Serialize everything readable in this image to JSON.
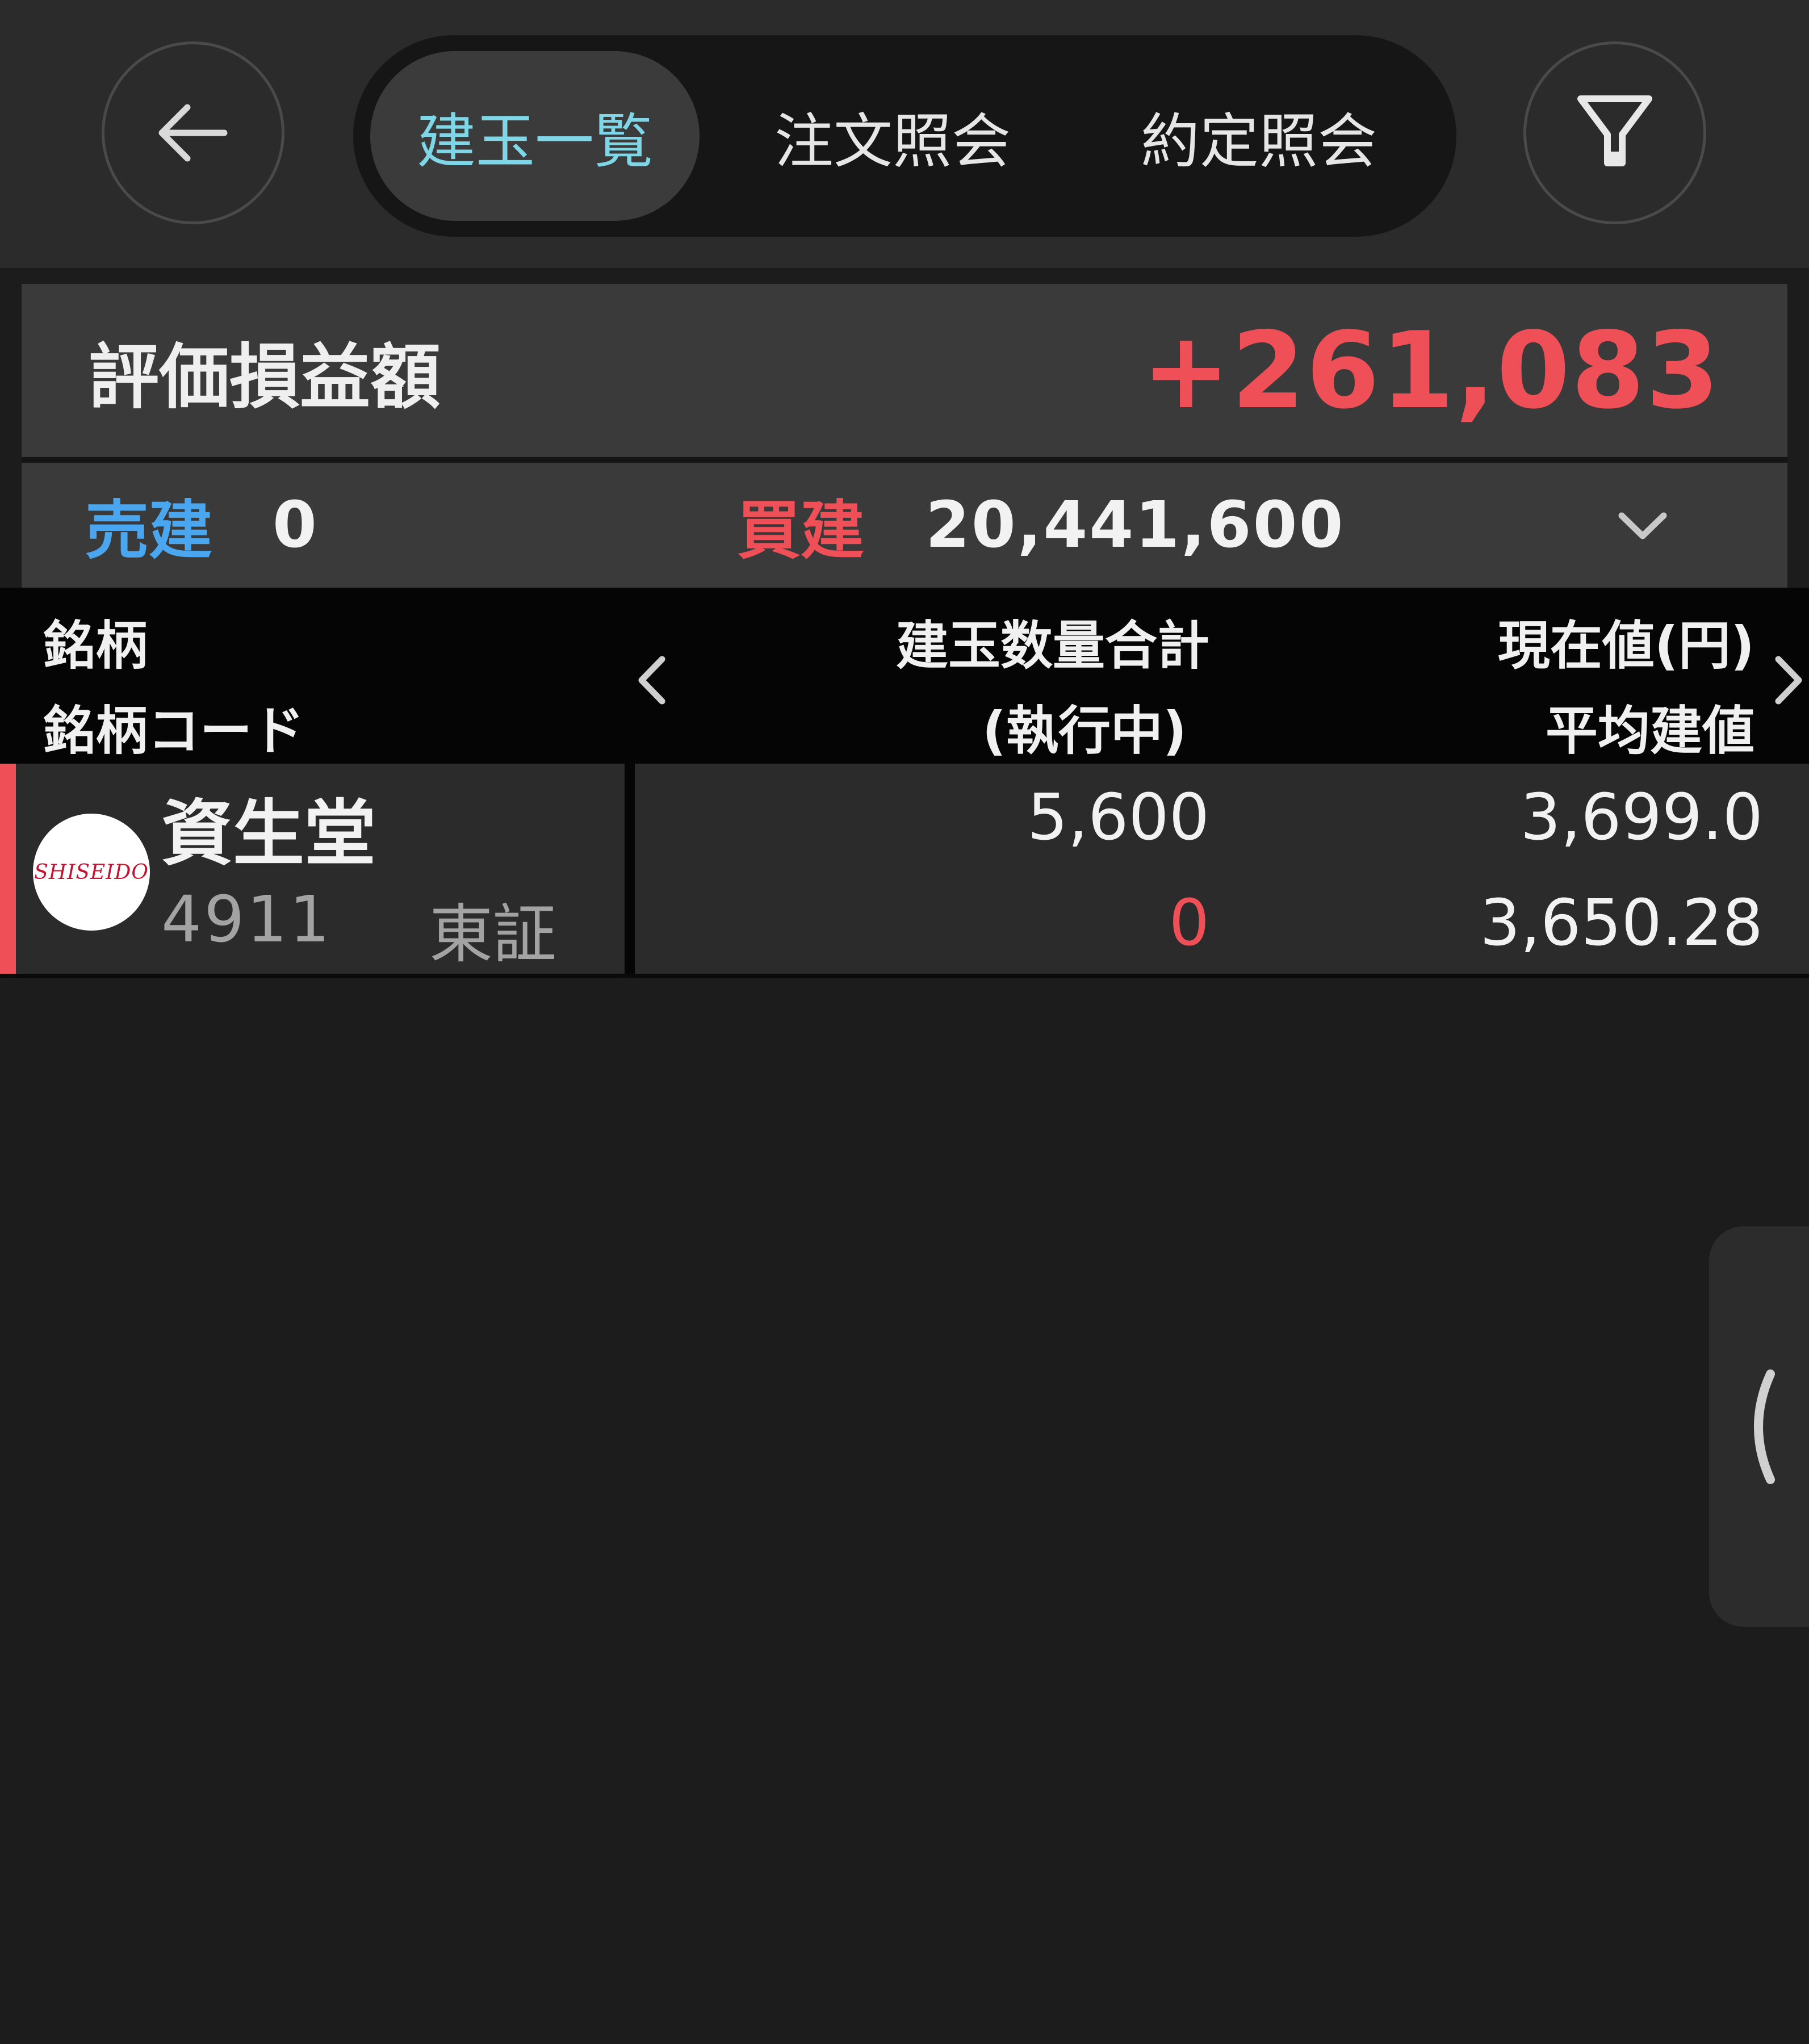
{
  "nav": {
    "tabs": [
      {
        "label": "建玉一覧",
        "active": true
      },
      {
        "label": "注文照会",
        "active": false
      },
      {
        "label": "約定照会",
        "active": false
      }
    ],
    "back_icon": "arrow-left-icon",
    "filter_icon": "filter-icon"
  },
  "summary": {
    "label": "評価損益額",
    "value": "+261,083"
  },
  "breakdown": {
    "sell_label": "売建",
    "sell_value": "0",
    "buy_label": "買建",
    "buy_value": "20,441,600"
  },
  "columns": {
    "name": "銘柄",
    "code": "銘柄コード",
    "quantity_total": "建玉数量合計",
    "executing": "(執行中)",
    "current_price": "現在値(円)",
    "average_price": "平均建値"
  },
  "positions": [
    {
      "logo_text": "SHISEIDO",
      "name": "資生堂",
      "code": "4911",
      "market": "東証",
      "quantity": "5,600",
      "executing": "0",
      "current_price": "3,699.0",
      "average_price": "3,650.28"
    }
  ],
  "colors": {
    "accent_teal": "#7fd6e6",
    "profit_red": "#ef4f56",
    "sell_blue": "#4aa6ef",
    "background": "#1c1c1c"
  }
}
